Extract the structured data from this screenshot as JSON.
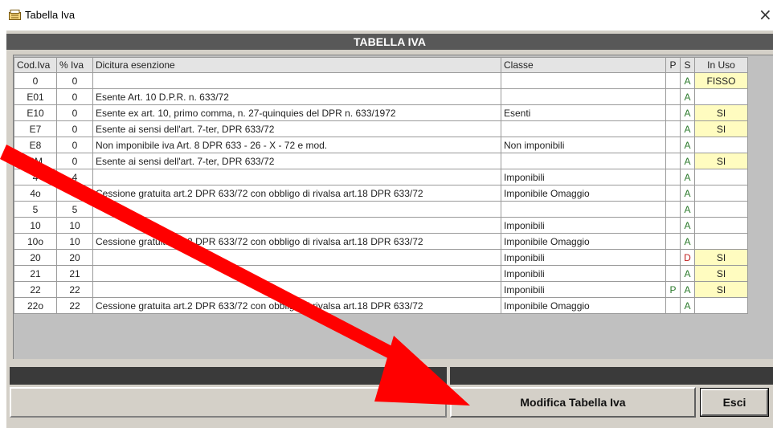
{
  "window": {
    "title": "Tabella Iva",
    "close_glyph": "×",
    "icon": "app-icon"
  },
  "banner": "TABELLA IVA",
  "table": {
    "headers": [
      "Cod.Iva",
      "% Iva",
      "Dicitura esenzione",
      "Classe",
      "P",
      "S",
      "In Uso"
    ],
    "rows": [
      {
        "code": "0",
        "pct": "0",
        "desc": "",
        "classe": "",
        "p": "",
        "s": "A",
        "uso": "FISSO"
      },
      {
        "code": "E01",
        "pct": "0",
        "desc": "Esente Art. 10 D.P.R. n. 633/72",
        "classe": "",
        "p": "",
        "s": "A",
        "uso": ""
      },
      {
        "code": "E10",
        "pct": "0",
        "desc": "Esente ex art. 10, primo comma, n. 27-quinquies del DPR n. 633/1972",
        "classe": "Esenti",
        "p": "",
        "s": "A",
        "uso": "SI"
      },
      {
        "code": "E7",
        "pct": "0",
        "desc": "Esente ai sensi dell'art. 7-ter, DPR 633/72",
        "classe": "",
        "p": "",
        "s": "A",
        "uso": "SI"
      },
      {
        "code": "E8",
        "pct": "0",
        "desc": "Non imponibile iva Art. 8 DPR 633 - 26 - X - 72 e mod.",
        "classe": "Non imponibili",
        "p": "",
        "s": "A",
        "uso": ""
      },
      {
        "code": "SM",
        "pct": "0",
        "desc": "Esente ai sensi dell'art. 7-ter, DPR 633/72",
        "classe": "",
        "p": "",
        "s": "A",
        "uso": "SI"
      },
      {
        "code": "4",
        "pct": "4",
        "desc": "",
        "classe": "Imponibili",
        "p": "",
        "s": "A",
        "uso": ""
      },
      {
        "code": "4o",
        "pct": "",
        "desc": "Cessione gratuita art.2 DPR 633/72 con obbligo di rivalsa art.18 DPR 633/72",
        "classe": "Imponibile Omaggio",
        "p": "",
        "s": "A",
        "uso": ""
      },
      {
        "code": "5",
        "pct": "5",
        "desc": "",
        "classe": "",
        "p": "",
        "s": "A",
        "uso": ""
      },
      {
        "code": "10",
        "pct": "10",
        "desc": "",
        "classe": "Imponibili",
        "p": "",
        "s": "A",
        "uso": ""
      },
      {
        "code": "10o",
        "pct": "10",
        "desc": "Cessione gratuita art.2 DPR 633/72 con obbligo di rivalsa art.18 DPR 633/72",
        "classe": "Imponibile Omaggio",
        "p": "",
        "s": "A",
        "uso": ""
      },
      {
        "code": "20",
        "pct": "20",
        "desc": "",
        "classe": "Imponibili",
        "p": "",
        "s": "D",
        "uso": "SI"
      },
      {
        "code": "21",
        "pct": "21",
        "desc": "",
        "classe": "Imponibili",
        "p": "",
        "s": "A",
        "uso": "SI"
      },
      {
        "code": "22",
        "pct": "22",
        "desc": "",
        "classe": "Imponibili",
        "p": "P",
        "s": "A",
        "uso": "SI"
      },
      {
        "code": "22o",
        "pct": "22",
        "desc": "Cessione gratuita art.2 DPR 633/72 con obbligo di rivalsa art.18 DPR 633/72",
        "classe": "Imponibile Omaggio",
        "p": "",
        "s": "A",
        "uso": ""
      }
    ]
  },
  "buttons": {
    "modifica": "Modifica Tabella Iva",
    "esci": "Esci"
  },
  "colors": {
    "banner": "#585858",
    "arrow": "#ff0000",
    "s_active": "#d7f4d7",
    "s_disabled": "#fadada",
    "in_use": "#fffcc0"
  },
  "overlay": {
    "icon": "red-arrow-annotation"
  }
}
